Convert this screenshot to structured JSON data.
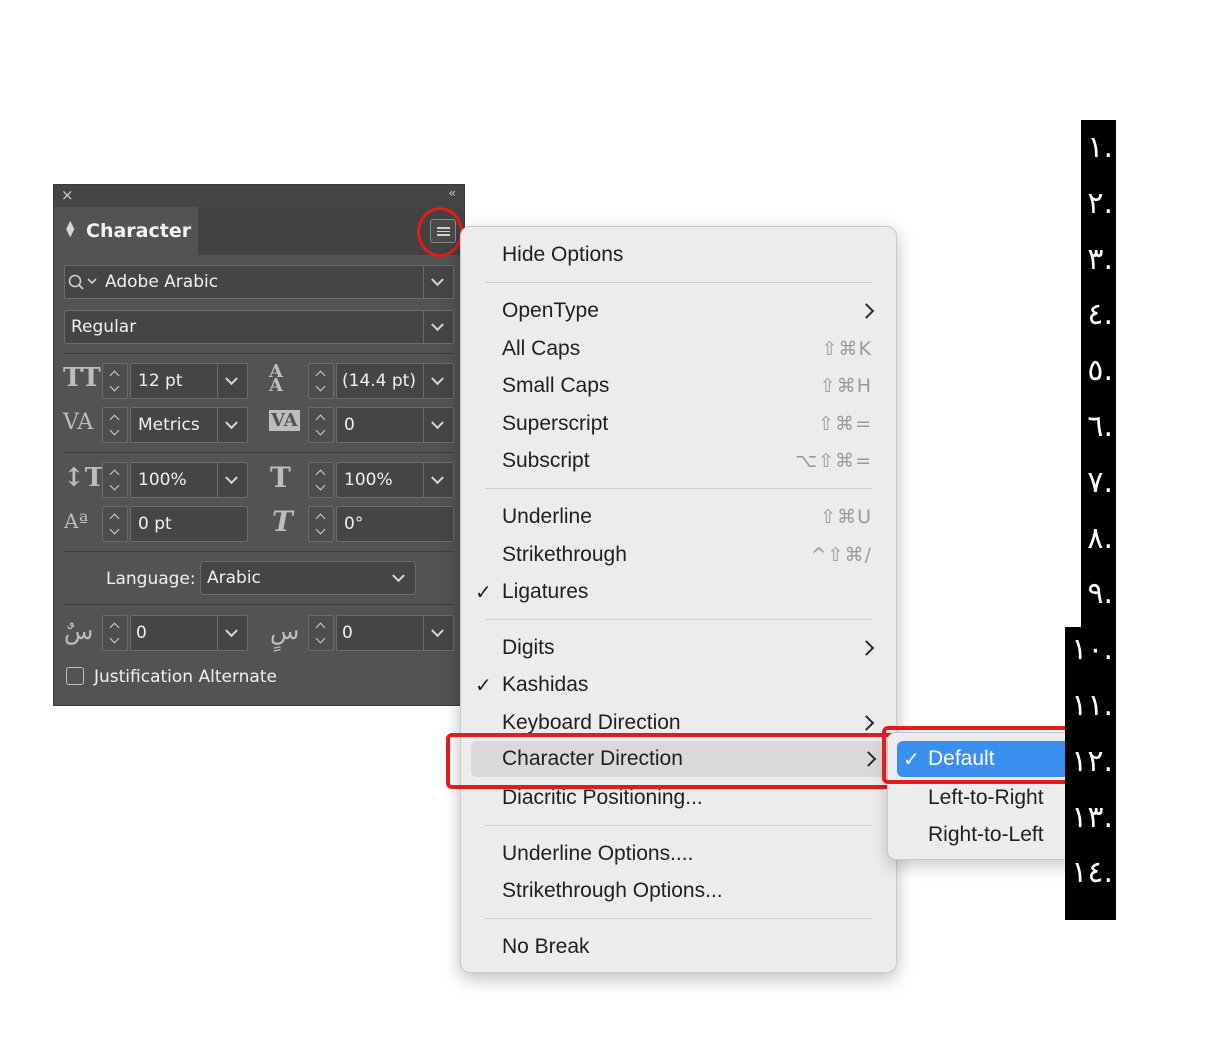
{
  "panel": {
    "close_icon": "×",
    "collapse_icon": "‹‹",
    "tab_title": "Character",
    "font_family": "Adobe Arabic",
    "font_style": "Regular",
    "font_size": "12 pt",
    "leading": "(14.4 pt)",
    "kerning": "Metrics",
    "tracking": "0",
    "vertical_scale": "100%",
    "horizontal_scale": "100%",
    "baseline_shift": "0 pt",
    "skew": "0°",
    "language_label": "Language:",
    "language_value": "Arabic",
    "insert_spacing": "0",
    "replace_spacing": "0",
    "justification_alternate": "Justification Alternate"
  },
  "menu": {
    "items": [
      {
        "label": "Hide Options"
      },
      {
        "label": "OpenType",
        "submenu": true
      },
      {
        "label": "All Caps",
        "shortcut": "⇧⌘K"
      },
      {
        "label": "Small Caps",
        "shortcut": "⇧⌘H"
      },
      {
        "label": "Superscript",
        "shortcut": "⇧⌘="
      },
      {
        "label": "Subscript",
        "shortcut": "⌥⇧⌘="
      },
      {
        "label": "Underline",
        "shortcut": "⇧⌘U"
      },
      {
        "label": "Strikethrough",
        "shortcut": "^⇧⌘/"
      },
      {
        "label": "Ligatures",
        "checked": true
      },
      {
        "label": "Digits",
        "submenu": true
      },
      {
        "label": "Kashidas",
        "checked": true
      },
      {
        "label": "Keyboard Direction",
        "submenu": true
      },
      {
        "label": "Character Direction",
        "submenu": true,
        "highlighted": true
      },
      {
        "label": "Diacritic Positioning..."
      },
      {
        "label": "Underline Options...."
      },
      {
        "label": "Strikethrough Options..."
      },
      {
        "label": "No Break"
      }
    ],
    "check_glyph": "✓"
  },
  "submenu": {
    "items": [
      {
        "label": "Default",
        "selected": true
      },
      {
        "label": "Left-to-Right"
      },
      {
        "label": "Right-to-Left"
      }
    ]
  },
  "numbers": [
    ".١",
    ".٢",
    ".٣",
    ".٤",
    ".٥",
    ".٦",
    ".٧",
    ".٨",
    ".٩",
    ".١٠",
    ".١١",
    ".١٢",
    ".١٣",
    ".١٤"
  ],
  "colors": {
    "panel_bg": "#535353",
    "menu_bg": "#ececec",
    "selection_blue": "#3a8eed",
    "annotation_red": "#e31b1b"
  }
}
